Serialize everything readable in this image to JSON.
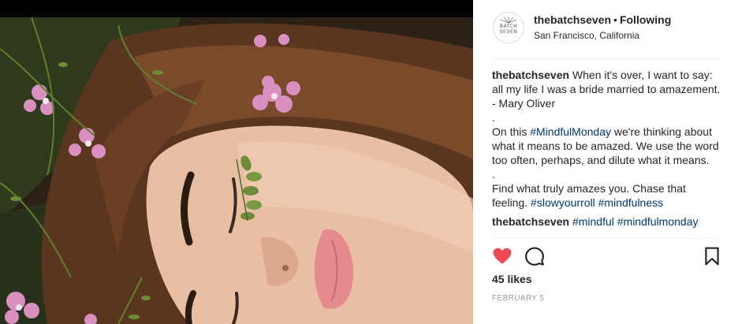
{
  "post": {
    "username": "thebatchseven",
    "separator": "•",
    "follow_state": "Following",
    "location": "San Francisco, California",
    "avatar_text_line1": "BATCH",
    "avatar_text_line2": "SEVEN",
    "image_alt": "Woman lying among flowers with leaves on cheek",
    "caption": {
      "user": "thebatchseven",
      "line1": " When it's over, I want to say: all my life I was a bride married to amazement. - Mary Oliver",
      "sep1": ".",
      "p2_pre": "On this ",
      "p2_tag": "#MindfulMonday",
      "p2_post": " we're thinking about what it means to be amazed. We use the word too often, perhaps, and dilute what it means.",
      "sep2": ".",
      "p3_pre": "Find what truly amazes you. Chase that feeling. ",
      "p3_tag1": "#slowyourroll",
      "p3_space": " ",
      "p3_tag2": "#mindfulness"
    },
    "comment": {
      "user": "thebatchseven",
      "tag1": "#mindful",
      "tag2": "#mindfulmonday"
    },
    "likes": "45 likes",
    "date": "FEBRUARY 5",
    "colors": {
      "like_active": "#ed4956",
      "hashtag": "#003569",
      "text": "#262626",
      "muted": "#999999"
    },
    "icons": [
      "heart-icon",
      "comment-icon",
      "bookmark-icon"
    ]
  }
}
